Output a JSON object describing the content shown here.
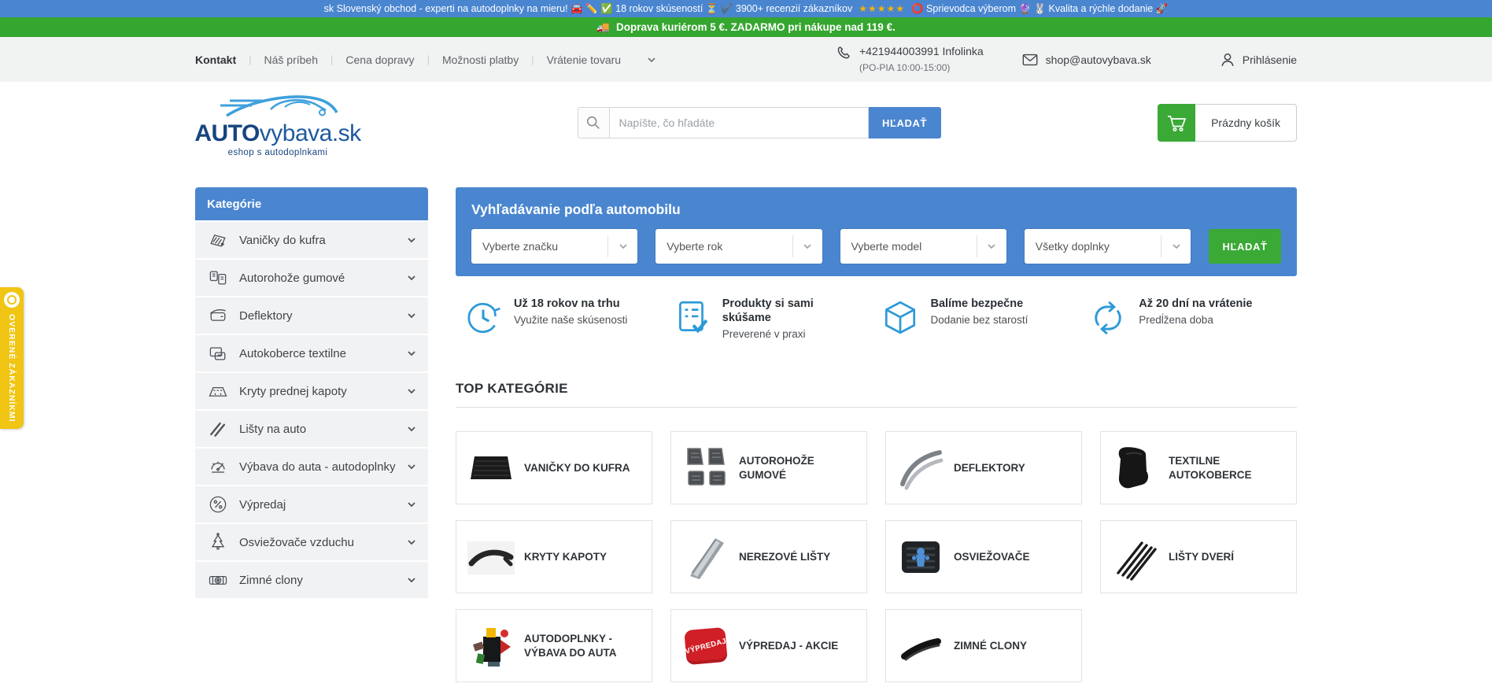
{
  "promo_bar": {
    "part1": "sk Slovenský obchod - experti na autodoplnky na mieru! 🚘 ✏️ ✅ 18 rokov skúseností ⏳ ✔️ 3900+ recenzií zákazníkov",
    "stars": "★★★★★",
    "part2": "⭕ Sprievodca výberom 🔮 🐰 Kvalita a rýchle dodanie 🚀"
  },
  "shipping_bar": {
    "icon": "🚚",
    "text": "Doprava kuriérom 5 €. ZADARMO pri nákupe nad 119 €."
  },
  "top_nav": {
    "links": [
      "Kontakt",
      "Náš príbeh",
      "Cena dopravy",
      "Možnosti platby",
      "Vrátenie tovaru"
    ],
    "phone": {
      "number": "+421944003991",
      "label": "Infolinka",
      "hours": "(PO-PIA 10:00-15:00)"
    },
    "email": "shop@autovybava.sk",
    "login": "Prihlásenie"
  },
  "header": {
    "logo": {
      "title_bold": "AUTO",
      "title_rest": "vybava.sk",
      "subtitle": "eshop s autodoplnkami"
    },
    "search": {
      "placeholder": "Napíšte, čo hľadáte",
      "button": "HĽADAŤ"
    },
    "cart": {
      "label": "Prázdny košík"
    }
  },
  "verified_badge": {
    "text": "OVERENÉ ZÁKAZNÍKMI"
  },
  "sidebar": {
    "title": "Kategórie",
    "items": [
      {
        "label": "Vaničky do kufra"
      },
      {
        "label": "Autorohože gumové"
      },
      {
        "label": "Deflektory"
      },
      {
        "label": "Autokoberce textilne"
      },
      {
        "label": "Kryty prednej kapoty"
      },
      {
        "label": "Lišty na auto"
      },
      {
        "label": "Výbava do auta - autodoplnky"
      },
      {
        "label": "Výpredaj"
      },
      {
        "label": "Osviežovače vzduchu"
      },
      {
        "label": "Zimné clony"
      }
    ]
  },
  "car_search": {
    "title": "Vyhľadávanie podľa automobilu",
    "selects": [
      "Vyberte značku",
      "Vyberte rok",
      "Vyberte model",
      "Všetky doplnky"
    ],
    "button": "HĽADAŤ"
  },
  "features": [
    {
      "title": "Už 18 rokov na trhu",
      "subtitle": "Využite naše skúsenosti"
    },
    {
      "title": "Produkty si sami skúšame",
      "subtitle": "Preverené v praxi"
    },
    {
      "title": "Balíme bezpečne",
      "subtitle": "Dodanie bez starostí"
    },
    {
      "title": "Až 20 dní na vrátenie",
      "subtitle": "Predĺžena doba"
    }
  ],
  "top_categories": {
    "title": "TOP KATEGÓRIE",
    "cards": [
      {
        "label": "VANIČKY DO KUFRA"
      },
      {
        "label": "AUTOROHOŽE GUMOVÉ"
      },
      {
        "label": "DEFLEKTORY"
      },
      {
        "label": "TEXTILNE AUTOKOBERCE"
      },
      {
        "label": "KRYTY KAPOTY"
      },
      {
        "label": "NEREZOVÉ LIŠTY"
      },
      {
        "label": "OSVIEŽOVAČE"
      },
      {
        "label": "LIŠTY DVERÍ"
      },
      {
        "label": "AUTODOPLNKY - VÝBAVA DO AUTA"
      },
      {
        "label": "VÝPREDAJ - AKCIE",
        "badge_text": "VÝPREDAJ"
      },
      {
        "label": "ZIMNÉ CLONY"
      }
    ]
  },
  "colors": {
    "promo_blue": "#4a86d0",
    "green": "#35a62f",
    "button_green": "#3aa935",
    "panel_blue": "#4a86d0",
    "feature_icon_blue": "#2d9ad8",
    "badge_gold": "#f0c514"
  }
}
